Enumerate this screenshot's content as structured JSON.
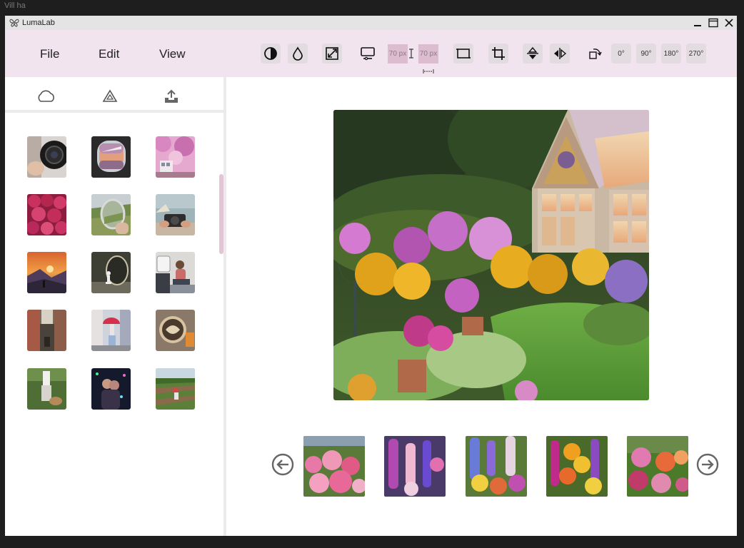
{
  "frame": {
    "label": "Vill ha"
  },
  "app": {
    "title": "LumaLab"
  },
  "menu": {
    "file": "File",
    "edit": "Edit",
    "view": "View"
  },
  "toolbar": {
    "width_placeholder": "70 px",
    "height_placeholder": "70 px",
    "rotations": [
      "0°",
      "90°",
      "180°",
      "270°"
    ]
  },
  "sources": [
    "cloud-icon",
    "google-drive-icon",
    "upload-icon"
  ],
  "thumbnails": [
    "camera-lens-photo",
    "airplane-window-photo",
    "cherry-blossom-train-photo",
    "raspberries-photo",
    "car-mirror-landscape-photo",
    "camera-coast-photo",
    "mountain-sunset-photo",
    "mirror-chess-piece-photo",
    "train-reader-photo",
    "narrow-alley-photo",
    "umbrella-street-photo",
    "coffee-art-photo",
    "dog-walk-photo",
    "night-couple-photo",
    "farm-field-photo"
  ],
  "main_image": "garden-greenhouse-photo",
  "filmstrip": [
    "dahlia-garden-photo",
    "foxglove-photo",
    "delphinium-photo",
    "lupine-marigold-photo",
    "cottage-garden-photo"
  ],
  "colors": {
    "toolbar_bg": "#f1e4ee",
    "accent": "#dcbccf",
    "scroll": "#e2c6d6"
  }
}
